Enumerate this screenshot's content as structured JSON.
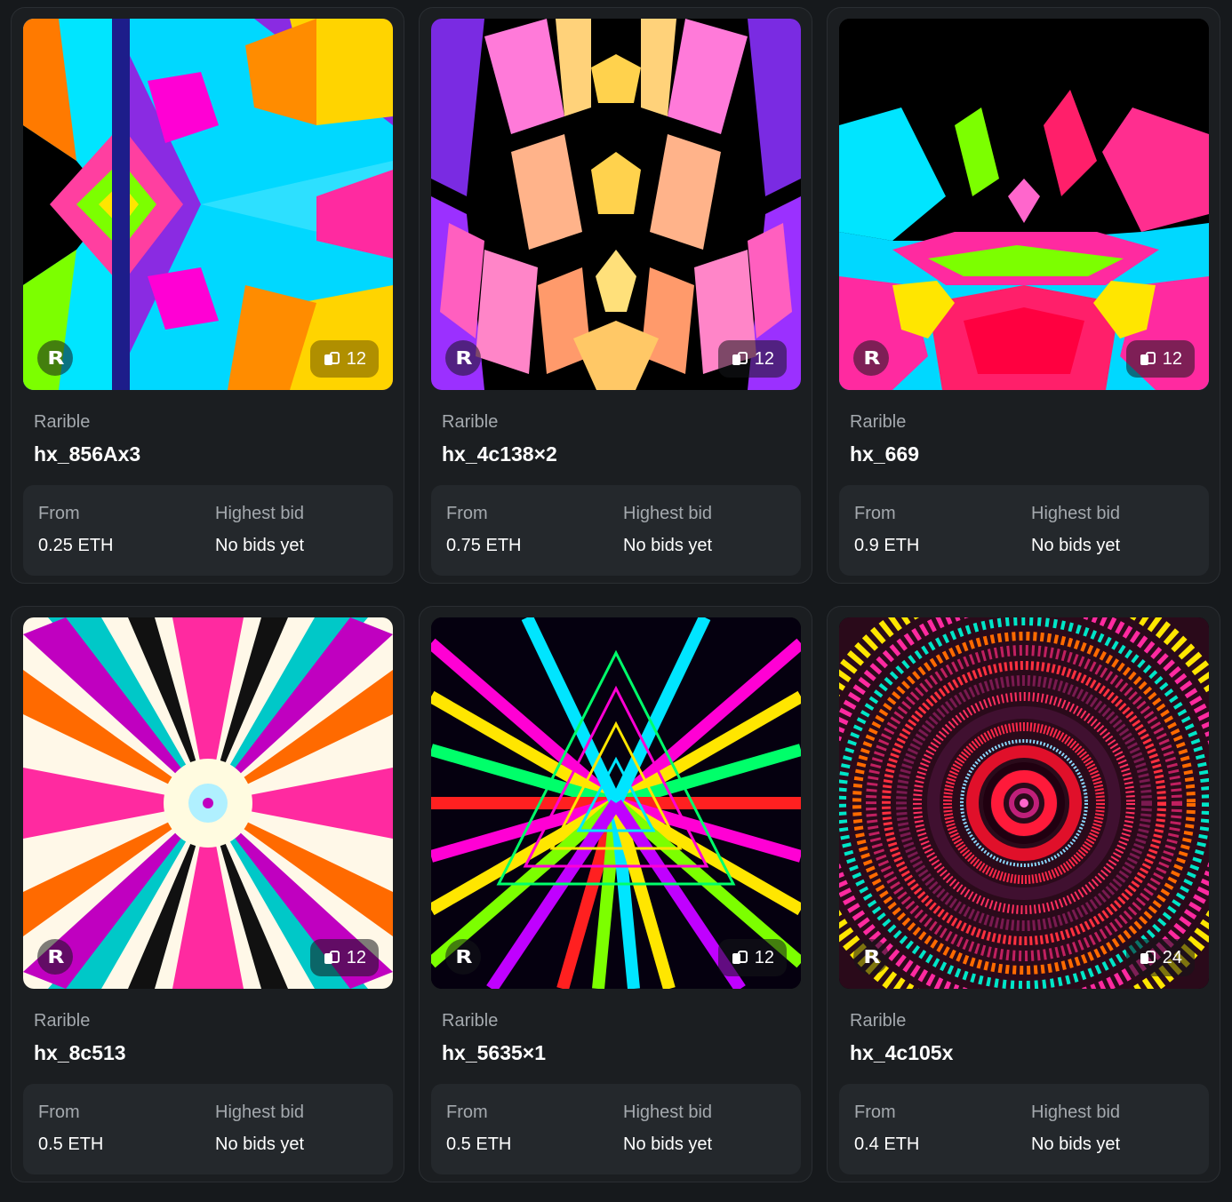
{
  "cards": [
    {
      "creator": "Rarible",
      "title": "hx_856Ax3",
      "from_label": "From",
      "price": "0.25 ETH",
      "bid_label": "Highest bid",
      "bid": "No bids yet",
      "edition_count": "12",
      "logo": "R"
    },
    {
      "creator": "Rarible",
      "title": "hx_4c138×2",
      "from_label": "From",
      "price": "0.75 ETH",
      "bid_label": "Highest bid",
      "bid": "No bids yet",
      "edition_count": "12",
      "logo": "R"
    },
    {
      "creator": "Rarible",
      "title": "hx_669",
      "from_label": "From",
      "price": "0.9 ETH",
      "bid_label": "Highest bid",
      "bid": "No bids yet",
      "edition_count": "12",
      "logo": "R"
    },
    {
      "creator": "Rarible",
      "title": "hx_8c513",
      "from_label": "From",
      "price": "0.5 ETH",
      "bid_label": "Highest bid",
      "bid": "No bids yet",
      "edition_count": "12",
      "logo": "R"
    },
    {
      "creator": "Rarible",
      "title": "hx_5635×1",
      "from_label": "From",
      "price": "0.5 ETH",
      "bid_label": "Highest bid",
      "bid": "No bids yet",
      "edition_count": "12",
      "logo": "R"
    },
    {
      "creator": "Rarible",
      "title": "hx_4c105x",
      "from_label": "From",
      "price": "0.4 ETH",
      "bid_label": "Highest bid",
      "bid": "No bids yet",
      "edition_count": "24",
      "logo": "R"
    }
  ],
  "colors": {
    "background": "#16191c",
    "card": "#1b1e21",
    "price_box": "#24282c",
    "muted_text": "#a4a9ae"
  },
  "icons": {
    "logo": "rarible-logo-icon",
    "edition": "copies-icon"
  }
}
